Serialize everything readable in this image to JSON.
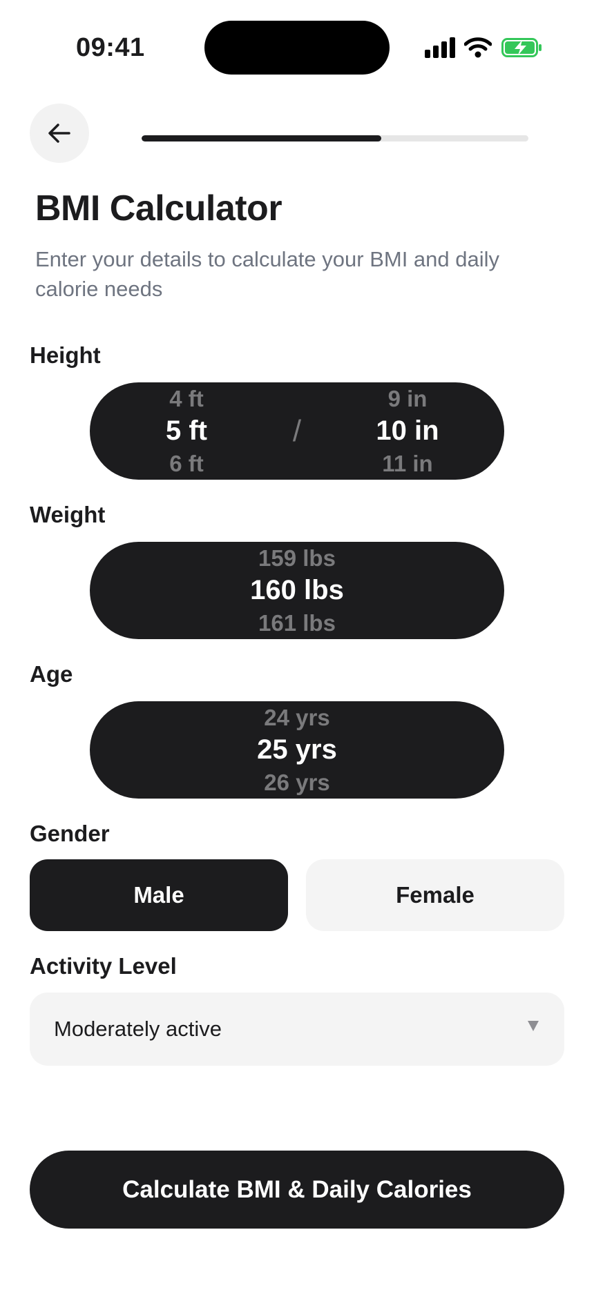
{
  "status_bar": {
    "time": "09:41"
  },
  "header": {
    "progress_percent": 62
  },
  "title": "BMI Calculator",
  "subtitle": "Enter your details to calculate your BMI and daily calorie needs",
  "height": {
    "label": "Height",
    "feet": {
      "prev": "4 ft",
      "selected": "5 ft",
      "next": "6 ft"
    },
    "separator": "/",
    "inches": {
      "prev": "9 in",
      "selected": "10 in",
      "next": "11 in"
    }
  },
  "weight": {
    "label": "Weight",
    "prev": "159 lbs",
    "selected": "160 lbs",
    "next": "161 lbs"
  },
  "age": {
    "label": "Age",
    "prev": "24 yrs",
    "selected": "25 yrs",
    "next": "26 yrs"
  },
  "gender": {
    "label": "Gender",
    "options": [
      "Male",
      "Female"
    ],
    "selected": "Male"
  },
  "activity": {
    "label": "Activity Level",
    "selected": "Moderately active"
  },
  "cta_label": "Calculate BMI & Daily Calories",
  "colors": {
    "primary": "#1c1c1e",
    "surface": "#f4f4f4",
    "muted_text": "#6e7480",
    "battery_green": "#34c759"
  },
  "icons": [
    "back-arrow-icon",
    "signal-icon",
    "wifi-icon",
    "battery-charging-icon",
    "chevron-down-icon"
  ]
}
